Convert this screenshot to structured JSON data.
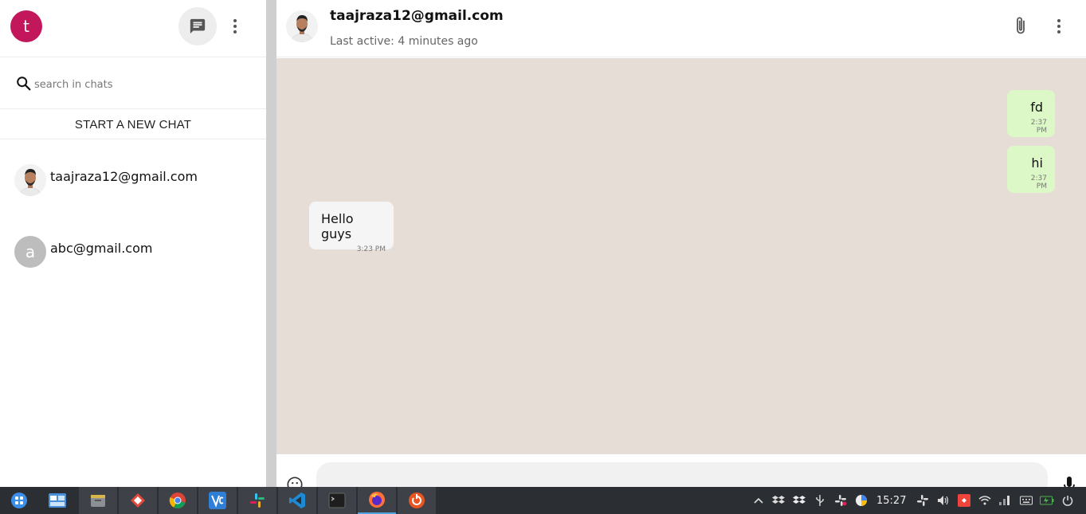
{
  "sidebar": {
    "user_initial": "t",
    "search_placeholder": "search in chats",
    "new_chat_label": "START A NEW CHAT",
    "chats": [
      {
        "name": "taajraza12@gmail.com",
        "avatar": "photo"
      },
      {
        "name": "abc@gmail.com",
        "avatar_letter": "a"
      }
    ]
  },
  "conversation": {
    "contact_name": "taajraza12@gmail.com",
    "last_active": "Last active: 4 minutes ago",
    "messages": [
      {
        "text": "fd",
        "time": "2:37 PM",
        "direction": "sent"
      },
      {
        "text": "hi",
        "time": "2:37 PM",
        "direction": "sent"
      },
      {
        "text": "Hello guys",
        "time": "3:23 PM",
        "direction": "received"
      }
    ]
  },
  "taskbar": {
    "clock": "15:27",
    "apps": [
      "launcher-icon",
      "workspaces-icon",
      "files-icon",
      "git-icon",
      "chrome-icon",
      "vscode-alt-icon",
      "slack-icon",
      "vscode-icon",
      "terminal-icon",
      "firefox-icon",
      "update-icon"
    ]
  },
  "colors": {
    "user_avatar": "#c2185b",
    "chat_background": "#e5ddd6",
    "sent_bubble": "#dcf8c6",
    "received_bubble": "#f5f5f5",
    "taskbar": "#2b2e33"
  }
}
